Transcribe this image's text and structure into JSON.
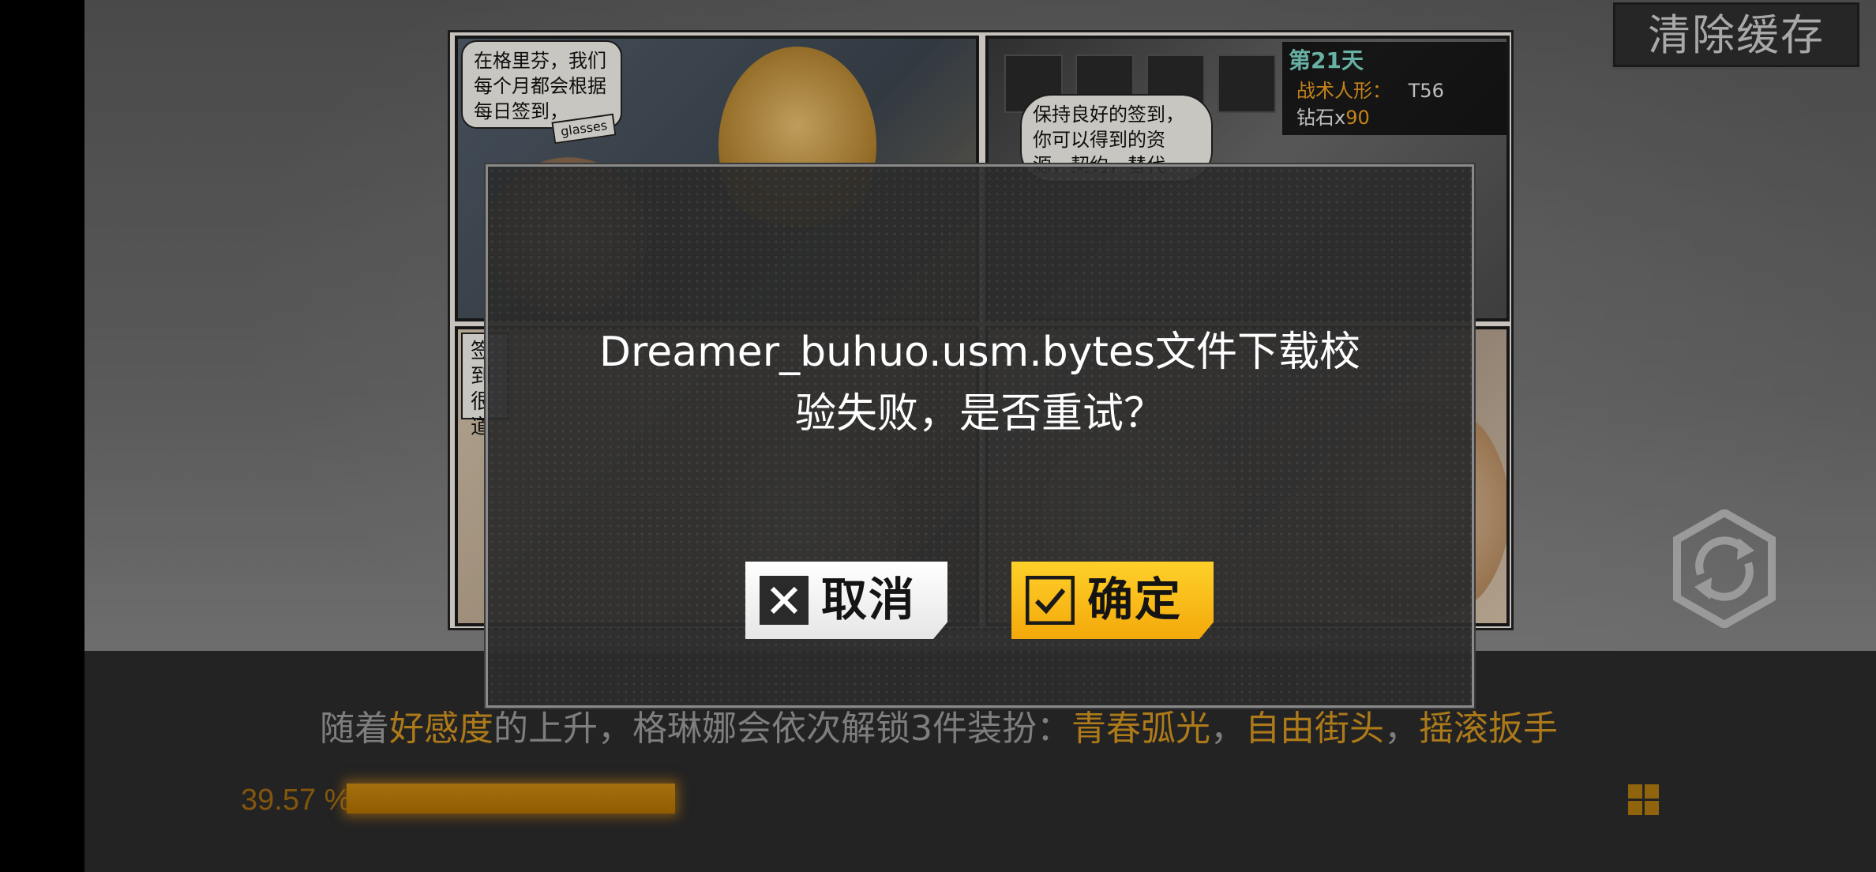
{
  "top_right": {
    "clear_cache_label": "清除缓存"
  },
  "comic": {
    "panel_a_bubble": "在格里芬，我们\n每个月都会根据\n每日签到，",
    "panel_a_tag": "glasses",
    "panel_b_bubble": "保持良好的签到，\n你可以得到的资\n源，契约，替代",
    "panel_c_caption": "签到\n很\n道",
    "reward": {
      "day": "第21天",
      "line1_label": "战术人形：",
      "line1_value": "T56",
      "line2_label": "钻石x",
      "line2_value": "90"
    }
  },
  "dialog": {
    "message": "Dreamer_buhuo.usm.bytes文件下载校\n验失败，是否重试？",
    "cancel_label": "取消",
    "confirm_label": "确定"
  },
  "tip": {
    "part1": "随着",
    "hl1": "好感度",
    "part2": "的上升，格琳娜会依次解锁3件装扮：",
    "hl2": "青春弧光",
    "sep1": "，",
    "hl3": "自由街头",
    "sep2": "，",
    "hl4": "摇滚扳手"
  },
  "progress": {
    "percent_text": "39.57 %",
    "value": 0.3957
  },
  "colors": {
    "accent": "#d49520",
    "confirm": "#f5b514",
    "cancel": "#ffffff"
  },
  "icons": {
    "cancel": "close-icon",
    "confirm": "check-icon",
    "refresh": "refresh-icon",
    "grid": "grid-icon"
  }
}
